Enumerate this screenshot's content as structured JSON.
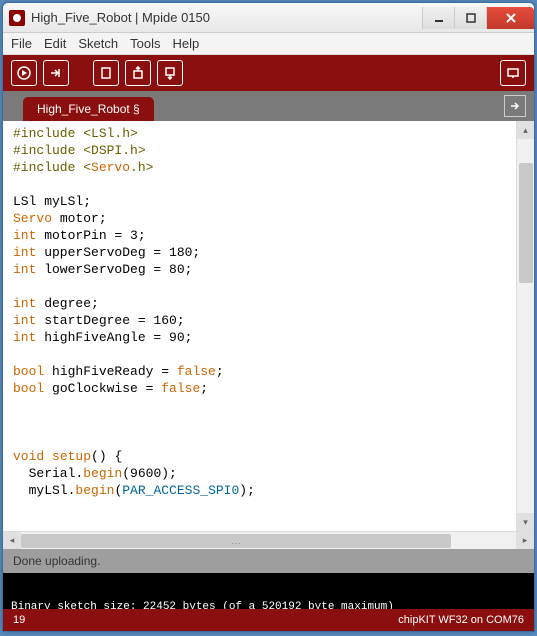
{
  "window": {
    "title": "High_Five_Robot | Mpide 0150"
  },
  "menu": {
    "file": "File",
    "edit": "Edit",
    "sketch": "Sketch",
    "tools": "Tools",
    "help": "Help"
  },
  "tab": {
    "name": "High_Five_Robot §"
  },
  "code": {
    "lines": [
      {
        "t": "pre",
        "c": "#include <LSl.h>"
      },
      {
        "t": "pre",
        "c": "#include <DSPI.h>"
      },
      {
        "t": "mix",
        "parts": [
          {
            "c": "#include <",
            "k": "pre"
          },
          {
            "c": "Servo",
            "k": "cls"
          },
          {
            "c": ".h>",
            "k": "pre"
          }
        ]
      },
      {
        "t": "blank"
      },
      {
        "t": "plain",
        "c": "LSl myLSl;"
      },
      {
        "t": "mix",
        "parts": [
          {
            "c": "Servo",
            "k": "cls"
          },
          {
            "c": " motor;",
            "k": ""
          }
        ]
      },
      {
        "t": "mix",
        "parts": [
          {
            "c": "int",
            "k": "type"
          },
          {
            "c": " motorPin = 3;",
            "k": ""
          }
        ]
      },
      {
        "t": "mix",
        "parts": [
          {
            "c": "int",
            "k": "type"
          },
          {
            "c": " upperServoDeg = 180;",
            "k": ""
          }
        ]
      },
      {
        "t": "mix",
        "parts": [
          {
            "c": "int",
            "k": "type"
          },
          {
            "c": " lowerServoDeg = 80;",
            "k": ""
          }
        ]
      },
      {
        "t": "blank"
      },
      {
        "t": "mix",
        "parts": [
          {
            "c": "int",
            "k": "type"
          },
          {
            "c": " degree;",
            "k": ""
          }
        ]
      },
      {
        "t": "mix",
        "parts": [
          {
            "c": "int",
            "k": "type"
          },
          {
            "c": " startDegree = 160;",
            "k": ""
          }
        ]
      },
      {
        "t": "mix",
        "parts": [
          {
            "c": "int",
            "k": "type"
          },
          {
            "c": " highFiveAngle = 90;",
            "k": ""
          }
        ]
      },
      {
        "t": "blank"
      },
      {
        "t": "mix",
        "parts": [
          {
            "c": "bool",
            "k": "type"
          },
          {
            "c": " highFiveReady = ",
            "k": ""
          },
          {
            "c": "false",
            "k": "rsv"
          },
          {
            "c": ";",
            "k": ""
          }
        ]
      },
      {
        "t": "mix",
        "parts": [
          {
            "c": "bool",
            "k": "type"
          },
          {
            "c": " goClockwise = ",
            "k": ""
          },
          {
            "c": "false",
            "k": "rsv"
          },
          {
            "c": ";",
            "k": ""
          }
        ]
      },
      {
        "t": "blank"
      },
      {
        "t": "blank"
      },
      {
        "t": "blank"
      },
      {
        "t": "mix",
        "parts": [
          {
            "c": "void",
            "k": "type"
          },
          {
            "c": " ",
            "k": ""
          },
          {
            "c": "setup",
            "k": "fn"
          },
          {
            "c": "() {",
            "k": ""
          }
        ]
      },
      {
        "t": "mix",
        "parts": [
          {
            "c": "  Serial.",
            "k": ""
          },
          {
            "c": "begin",
            "k": "fn"
          },
          {
            "c": "(9600);",
            "k": ""
          }
        ]
      },
      {
        "t": "mix",
        "parts": [
          {
            "c": "  myLSl.",
            "k": ""
          },
          {
            "c": "begin",
            "k": "fn"
          },
          {
            "c": "(",
            "k": ""
          },
          {
            "c": "PAR_ACCESS_SPI0",
            "k": "const"
          },
          {
            "c": ");",
            "k": ""
          }
        ]
      }
    ]
  },
  "status": {
    "text": "Done uploading."
  },
  "console": {
    "text": "Binary sketch size: 22452 bytes (of a 520192 byte maximum)"
  },
  "footer": {
    "line": "19",
    "board": "chipKIT WF32 on COM76"
  }
}
